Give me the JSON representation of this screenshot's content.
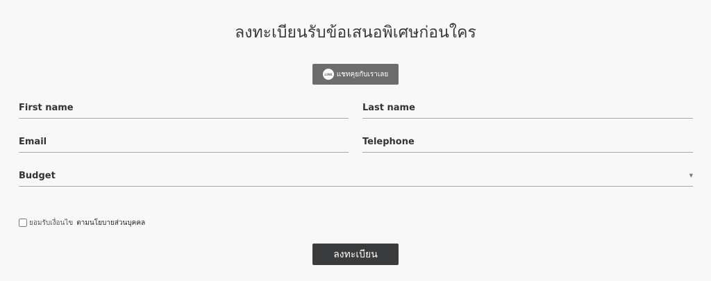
{
  "page": {
    "title": "ลงทะเบียนรับข้อเสนอพิเศษก่อนใคร"
  },
  "line_chat": {
    "icon": "line-chat-icon",
    "icon_text": "LINE",
    "label": "แชทคุยกับเราเลย"
  },
  "form": {
    "first_name": {
      "placeholder": "First name",
      "value": ""
    },
    "last_name": {
      "placeholder": "Last name",
      "value": ""
    },
    "email": {
      "placeholder": "Email",
      "value": ""
    },
    "telephone": {
      "placeholder": "Telephone",
      "value": ""
    },
    "budget": {
      "selected": "Budget",
      "arrow_icon": "caret-down-icon"
    },
    "consent": {
      "checked": false,
      "text": "ยอมรับเงื่อนไข",
      "link_text": "ตามนโยบายส่วนบุคคล"
    },
    "submit_label": "ลงทะเบียน"
  },
  "colors": {
    "background": "#f8f8f8",
    "line_button": "#6d6d6d",
    "submit_button": "#3a3b3c",
    "underline": "#a8a8a8"
  }
}
